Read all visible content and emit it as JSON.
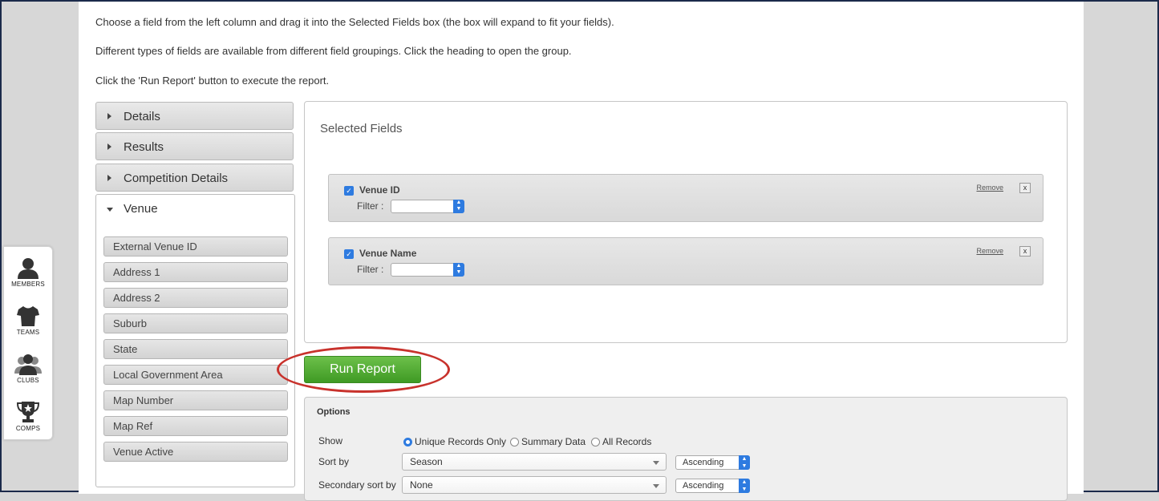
{
  "instructions": [
    "Choose a field from the left column and drag it into the Selected Fields box (the box will expand to fit your fields).",
    "Different types of fields are available from different field groupings. Click the heading to open the group.",
    "Click the 'Run Report' button to execute the report."
  ],
  "quicknav": [
    "MEMBERS",
    "TEAMS",
    "CLUBS",
    "COMPS"
  ],
  "groups": {
    "details": "Details",
    "results": "Results",
    "competition_details": "Competition Details",
    "venue": "Venue"
  },
  "venue_fields": [
    "External Venue ID",
    "Address 1",
    "Address 2",
    "Suburb",
    "State",
    "Local Government Area",
    "Map Number",
    "Map Ref",
    "Venue Active"
  ],
  "selected": {
    "title": "Selected Fields",
    "fields": [
      {
        "name": "Venue ID",
        "filter_label": "Filter :",
        "remove": "Remove",
        "x": "x"
      },
      {
        "name": "Venue Name",
        "filter_label": "Filter :",
        "remove": "Remove",
        "x": "x"
      }
    ]
  },
  "run_report": "Run Report",
  "options": {
    "title": "Options",
    "show_label": "Show",
    "show_options": [
      "Unique Records Only",
      "Summary Data",
      "All Records"
    ],
    "show_selected": "Unique Records Only",
    "sort_by_label": "Sort by",
    "sort_by_value": "Season",
    "sort_by_order": "Ascending",
    "secondary_label": "Secondary sort by",
    "secondary_value": "None",
    "secondary_order": "Ascending"
  },
  "colors": {
    "accent": "#2e7be0",
    "run_button": "#4fa92f",
    "highlight_ellipse": "#c8322c"
  }
}
